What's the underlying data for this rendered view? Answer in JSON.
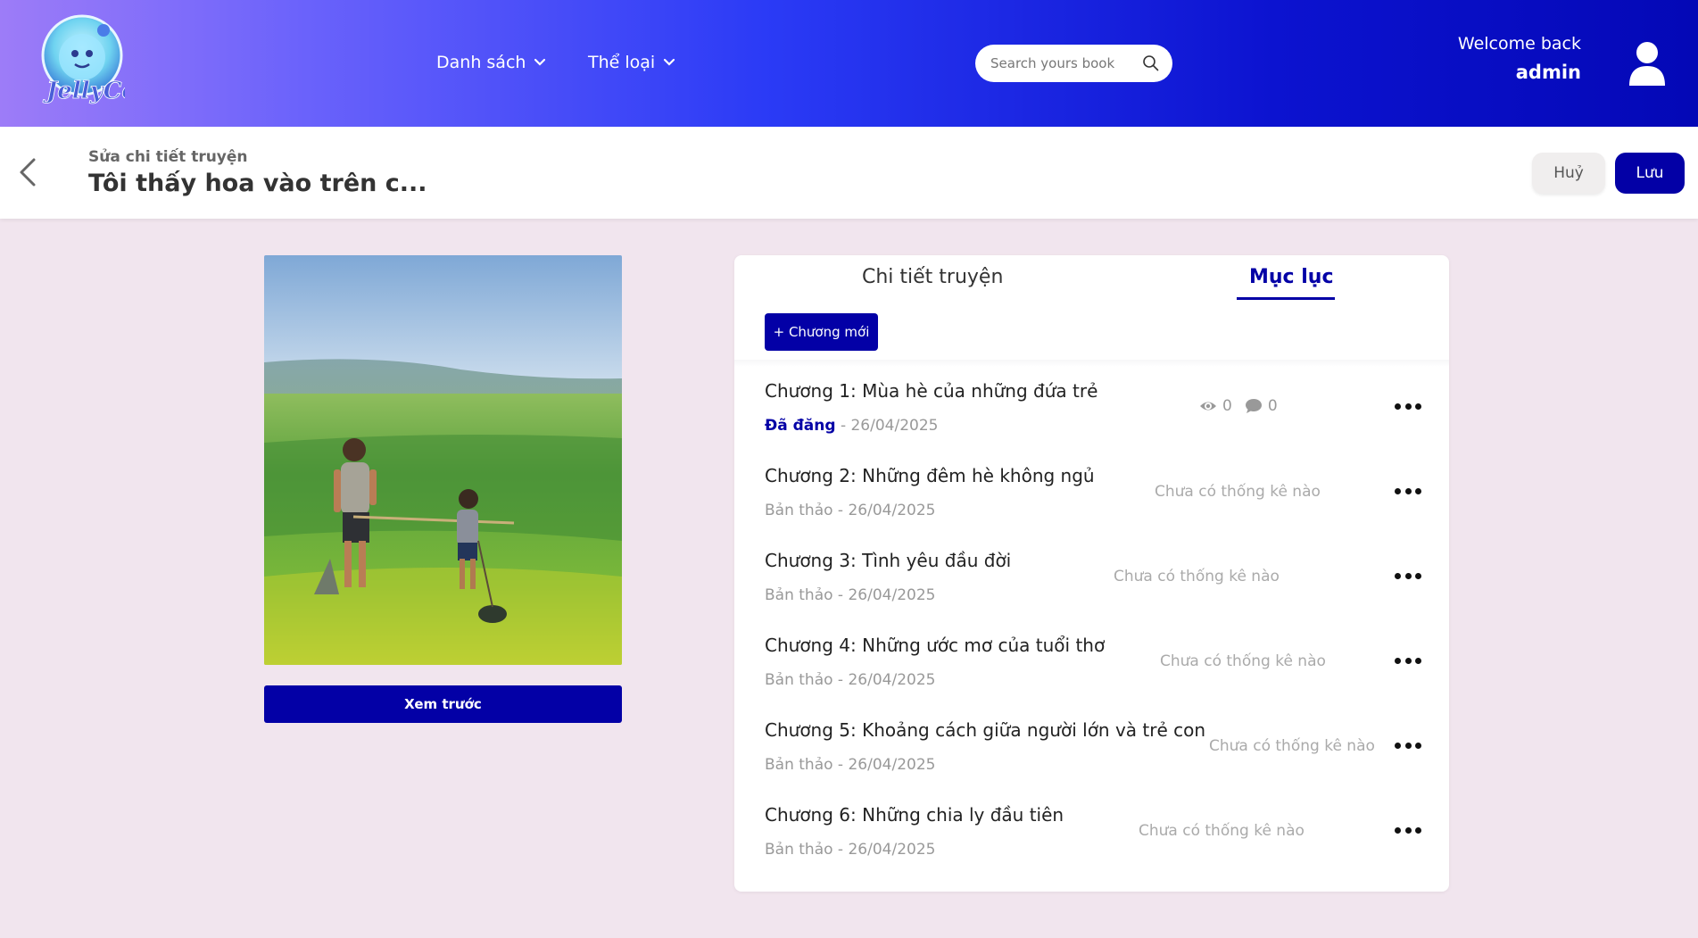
{
  "header": {
    "logo_text": "JellyCo",
    "nav": [
      {
        "label": "Danh sách"
      },
      {
        "label": "Thể loại"
      }
    ],
    "search": {
      "placeholder": "Search yours book",
      "value": ""
    },
    "welcome": "Welcome back",
    "username": "admin"
  },
  "subheader": {
    "label": "Sửa chi tiết truyện",
    "title": "Tôi thấy hoa vào trên c...",
    "cancel_label": "Huỷ",
    "save_label": "Lưu"
  },
  "cover": {
    "preview_label": "Xem trước"
  },
  "panel": {
    "tabs": [
      {
        "label": "Chi tiết truyện",
        "active": false
      },
      {
        "label": "Mục lục",
        "active": true
      }
    ],
    "new_chapter_label": "+ Chương mới",
    "chapters": [
      {
        "title": "Chương 1: Mùa hè của những đứa trẻ",
        "status": "Đã đăng",
        "date": " - 26/04/2025",
        "views": "0",
        "comments": "0",
        "stats_text": ""
      },
      {
        "title": "Chương 2: Những đêm hè không ngủ",
        "status": "Bản thảo",
        "date": " - 26/04/2025",
        "stats_text": "Chưa có thống kê nào"
      },
      {
        "title": "Chương 3: Tình yêu đầu đời",
        "status": "Bản thảo",
        "date": " - 26/04/2025",
        "stats_text": "Chưa có thống kê nào"
      },
      {
        "title": "Chương 4: Những ước mơ của tuổi thơ",
        "status": "Bản thảo",
        "date": " - 26/04/2025",
        "stats_text": "Chưa có thống kê nào"
      },
      {
        "title": "Chương 5: Khoảng cách giữa người lớn và trẻ con",
        "status": "Bản thảo",
        "date": " - 26/04/2025",
        "stats_text": "Chưa có thống kê nào"
      },
      {
        "title": "Chương 6: Những chia ly đầu tiên",
        "status": "Bản thảo",
        "date": " - 26/04/2025",
        "stats_text": "Chưa có thống kê nào"
      }
    ]
  },
  "colors": {
    "primary": "#0300a6",
    "page_bg": "#f1e5ee",
    "header_gradient_start": "#9d7cf8",
    "header_gradient_end": "#0408b6"
  }
}
